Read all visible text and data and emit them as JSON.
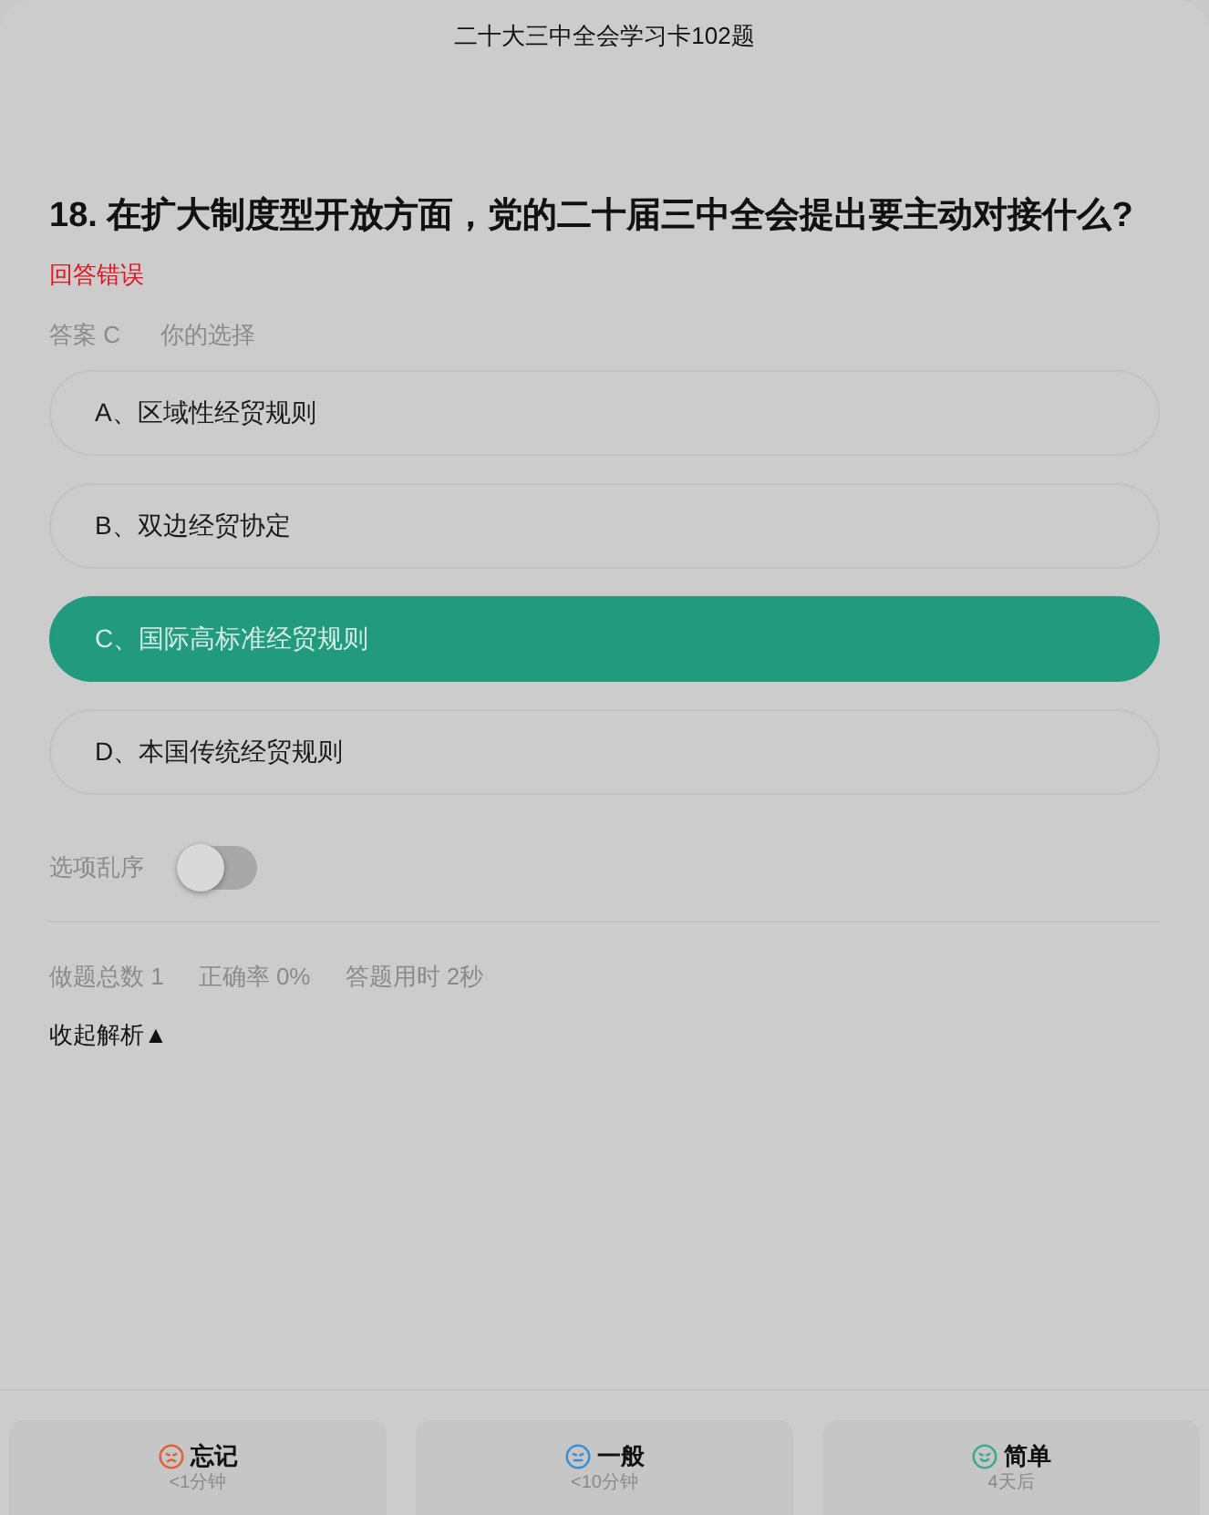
{
  "header": {
    "title": "二十大三中全会学习卡102题"
  },
  "question": {
    "text": "18. 在扩大制度型开放方面，党的二十届三中全会提出要主动对接什么?"
  },
  "result": {
    "text": "回答错误",
    "correct": false
  },
  "answer_line": {
    "answer": "答案 C",
    "your_choice": "你的选择"
  },
  "options": [
    {
      "label": "A、区域性经贸规则",
      "selected": false
    },
    {
      "label": "B、双边经贸协定",
      "selected": false
    },
    {
      "label": "C、国际高标准经贸规则",
      "selected": true
    },
    {
      "label": "D、本国传统经贸规则",
      "selected": false
    }
  ],
  "shuffle": {
    "label": "选项乱序",
    "on": false
  },
  "stats": [
    "做题总数 1",
    "正确率 0%",
    "答题用时 2秒"
  ],
  "analysis_toggle": {
    "label": "收起解析▲"
  },
  "ratings": [
    {
      "kind": "forgot",
      "label": "忘记",
      "interval": "<1分钟",
      "color": "#dd6236"
    },
    {
      "kind": "normal",
      "label": "一般",
      "interval": "<10分钟",
      "color": "#3a8ed4"
    },
    {
      "kind": "easy",
      "label": "简单",
      "interval": "4天后",
      "color": "#41a88a"
    }
  ]
}
